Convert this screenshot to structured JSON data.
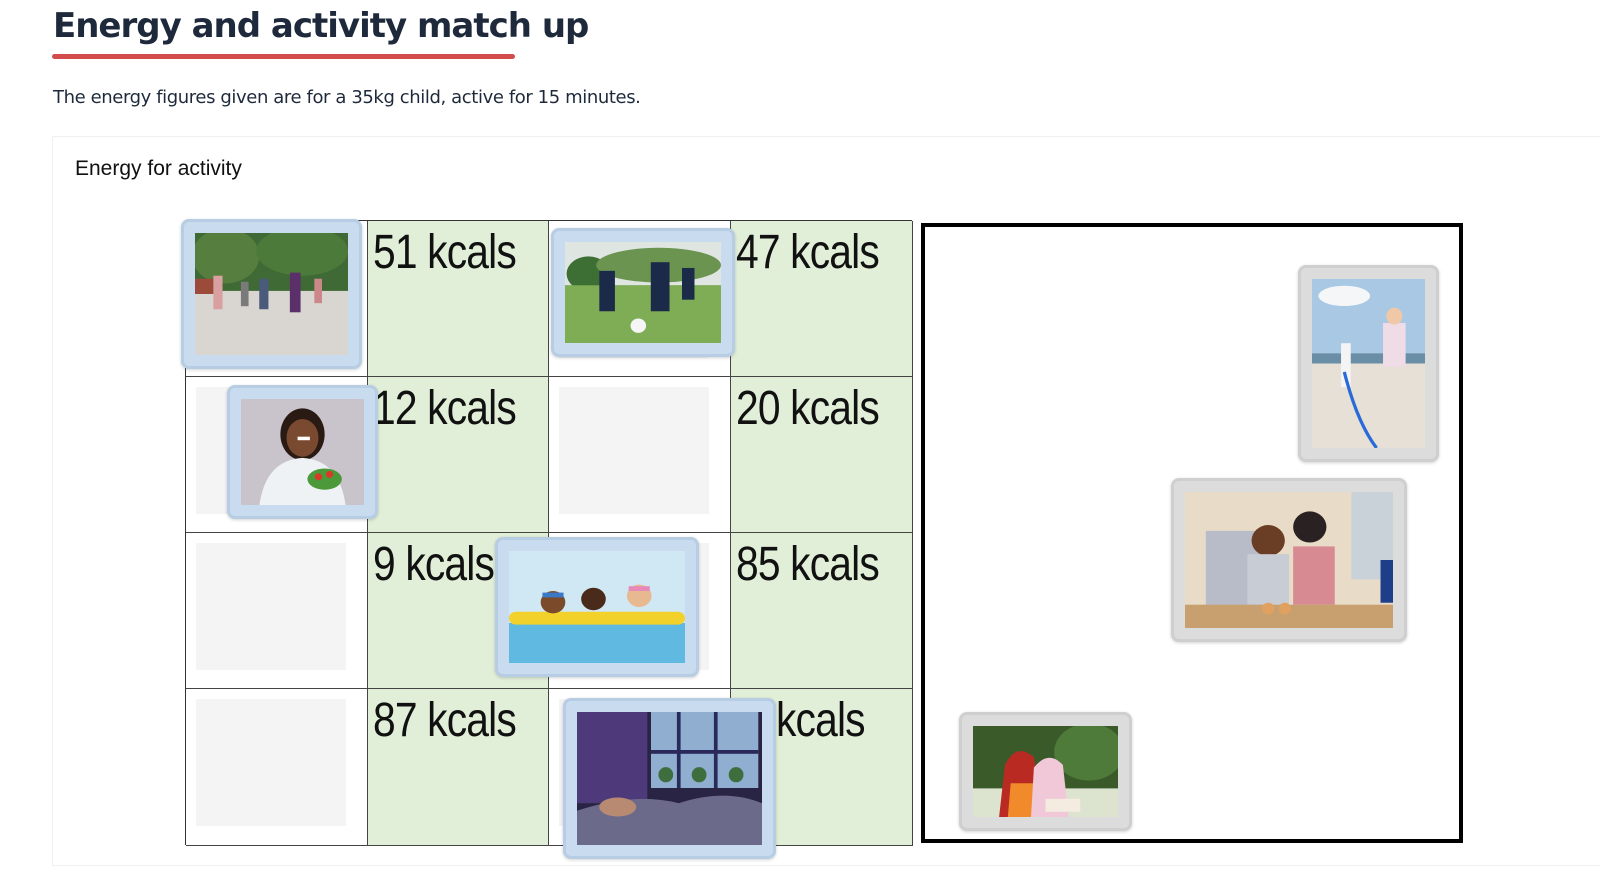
{
  "header": {
    "title": "Energy and activity match up",
    "intro": "The energy figures given are for a 35kg child, active for 15 minutes."
  },
  "activity": {
    "title": "Energy for activity",
    "grid": {
      "rows": [
        [
          {
            "type": "drop",
            "card": "running"
          },
          {
            "type": "label",
            "text": "51 kcals"
          },
          {
            "type": "drop",
            "card": "football"
          },
          {
            "type": "label",
            "text": "47 kcals"
          }
        ],
        [
          {
            "type": "drop",
            "card": "eating"
          },
          {
            "type": "label",
            "text": "12 kcals"
          },
          {
            "type": "drop",
            "card": null
          },
          {
            "type": "label",
            "text": "20 kcals"
          }
        ],
        [
          {
            "type": "drop",
            "card": null
          },
          {
            "type": "label",
            "text": "9 kcals"
          },
          {
            "type": "drop",
            "card": "swimming"
          },
          {
            "type": "label",
            "text": "85 kcals"
          }
        ],
        [
          {
            "type": "drop",
            "card": null
          },
          {
            "type": "label",
            "text": "87 kcals"
          },
          {
            "type": "drop",
            "card": "sleeping"
          },
          {
            "type": "label",
            "text": "kcals"
          }
        ]
      ]
    },
    "cards": [
      {
        "id": "running",
        "image": "children-running-icon",
        "state": "placed"
      },
      {
        "id": "football",
        "image": "children-playing-football-icon",
        "state": "placed"
      },
      {
        "id": "eating",
        "image": "girl-eating-salad-icon",
        "state": "placed"
      },
      {
        "id": "swimming",
        "image": "children-swimming-icon",
        "state": "placed"
      },
      {
        "id": "sleeping",
        "image": "child-sleeping-icon",
        "state": "placed"
      },
      {
        "id": "skipping",
        "image": "girl-skipping-rope-icon",
        "state": "unplaced"
      },
      {
        "id": "baking",
        "image": "child-baking-with-parent-icon",
        "state": "unplaced"
      },
      {
        "id": "reading",
        "image": "girls-reading-icon",
        "state": "unplaced"
      }
    ]
  },
  "colors": {
    "title_underline": "#d24c4c",
    "label_cell_bg": "#e1eed8",
    "placed_card_bg": "#c9dcef",
    "unplaced_card_bg": "#dcdcdc"
  }
}
